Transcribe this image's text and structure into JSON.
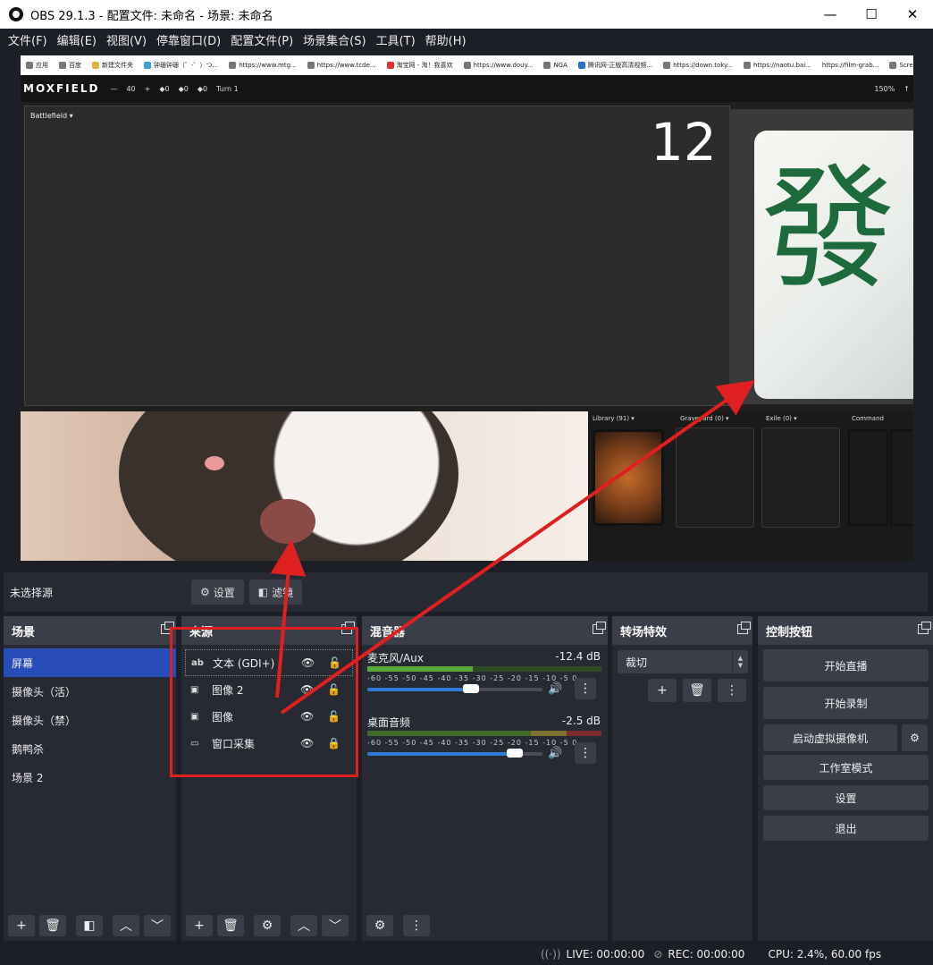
{
  "window": {
    "title": "OBS 29.1.3 - 配置文件: 未命名 - 场景: 未命名",
    "minimize": "—",
    "maximize": "☐",
    "close": "✕"
  },
  "menu": [
    "文件(F)",
    "编辑(E)",
    "视图(V)",
    "停靠窗口(D)",
    "配置文件(P)",
    "场景集合(S)",
    "工具(T)",
    "帮助(H)"
  ],
  "preview": {
    "bookmarks": [
      "应用",
      "百度",
      "新建文件夹",
      "钟珊钟珊（゜-゜）つ...",
      "https://www.mtg...",
      "https://www.tcde...",
      "淘宝网 - 淘！我喜欢",
      "https://www.douy...",
      "NGA",
      "腾讯网-正版高清视频...",
      "https://down.toky...",
      "https://naotu.bai...",
      "https://film-grab...",
      "Screenmusings"
    ],
    "moxfield": {
      "brand": "MOXFIELD",
      "life_minus": "—",
      "life": "40",
      "life_plus": "+",
      "poison": "◆0",
      "energy": "◆0",
      "exp": "◆0",
      "turn": "Turn 1",
      "zoom": "150%",
      "arrow": "↑"
    },
    "battlefield_label": "Battlefield ▾",
    "big_number": "12",
    "tile_char": "發",
    "zones": {
      "library": "Library (91) ▾",
      "graveyard": "Graveyard (0) ▾",
      "exile": "Exile (0) ▾",
      "command": "Command"
    }
  },
  "source_bar": {
    "no_selection": "未选择源",
    "settings": "设置",
    "filters": "滤镜"
  },
  "scenes": {
    "title": "场景",
    "items": [
      "屏幕",
      "摄像头（活）",
      "摄像头（禁）",
      "鹅鸭杀",
      "场景 2"
    ],
    "active_index": 0
  },
  "sources": {
    "title": "来源",
    "items": [
      {
        "icon": "ab",
        "name": "文本 (GDI+)",
        "locked": false
      },
      {
        "icon": "▣",
        "name": "图像 2",
        "locked": false
      },
      {
        "icon": "▣",
        "name": "图像",
        "locked": false
      },
      {
        "icon": "▭",
        "name": "窗口采集",
        "locked": true
      }
    ]
  },
  "mixer": {
    "title": "混音器",
    "channels": [
      {
        "name": "麦克风/Aux",
        "db": "-12.4 dB",
        "volume": 0.59,
        "meter": 0.45
      },
      {
        "name": "桌面音频",
        "db": "-2.5 dB",
        "volume": 0.84,
        "meter": 0.0
      }
    ],
    "ticks": "-60 -55 -50 -45 -40 -35 -30 -25 -20 -15 -10 -5 0"
  },
  "transitions": {
    "title": "转场特效",
    "selected": "裁切"
  },
  "controls": {
    "title": "控制按钮",
    "buttons": [
      "开始直播",
      "开始录制",
      "启动虚拟摄像机",
      "工作室模式",
      "设置",
      "退出"
    ]
  },
  "status": {
    "live": "LIVE: 00:00:00",
    "rec": "REC: 00:00:00",
    "cpu": "CPU: 2.4%, 60.00 fps"
  },
  "colors": {
    "accent": "#284cb8",
    "annotation": "#e02020",
    "bg": "#1d1f26",
    "panel": "#272a33",
    "control": "#3b3e48"
  }
}
